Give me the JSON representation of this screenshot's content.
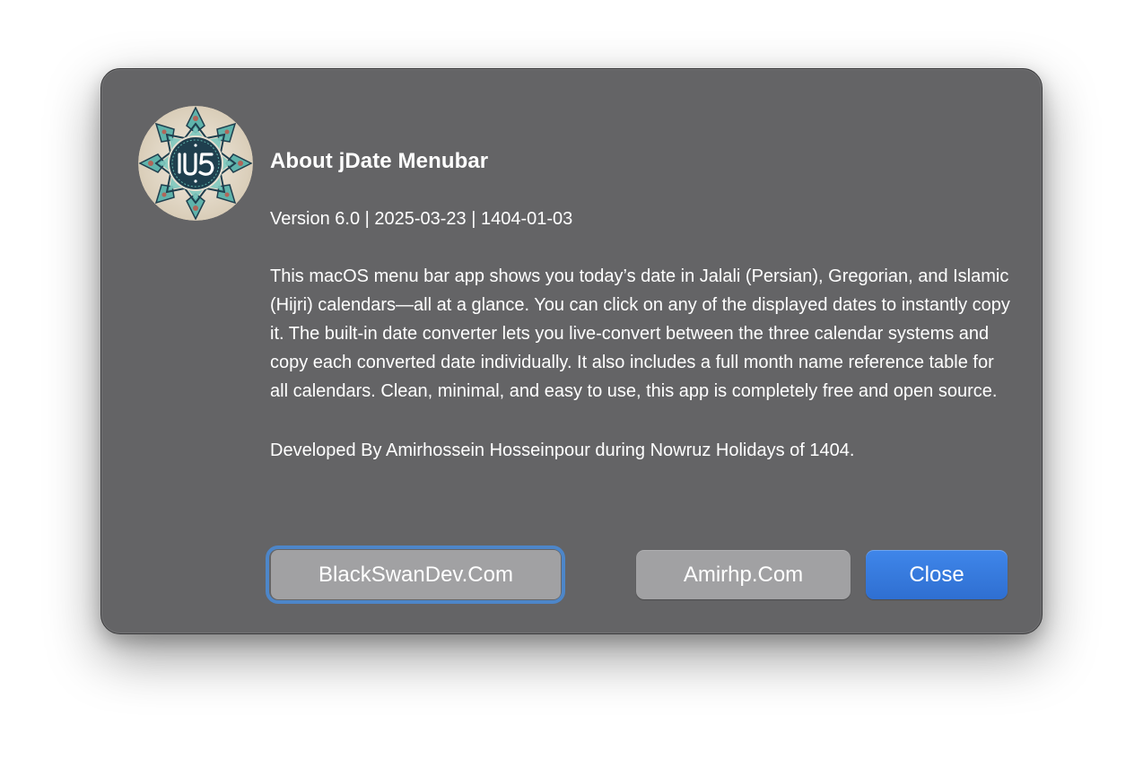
{
  "dialog": {
    "title": "About jDate Menubar",
    "version_line": "Version 6.0 | 2025-03-23 | 1404-01-03",
    "description": "This macOS menu bar app shows you today’s date in Jalali (Persian), Gregorian, and Islamic (Hijri) calendars—all at a glance. You can click on any of the displayed dates to instantly copy it. The built-in date converter lets you live-convert between the three calendar systems and copy each converted date individually. It also includes a full month name reference table for all calendars. Clean, minimal, and easy to use, this app is completely free and open source.",
    "developer_line": "Developed By Amirhossein Hosseinpour during Nowruz Holidays of 1404.",
    "app_icon": "jdate-app-icon",
    "buttons": {
      "blackswan_label": "BlackSwanDev.Com",
      "amirhp_label": "Amirhp.Com",
      "close_label": "Close"
    }
  },
  "colors": {
    "dialog_background": "#646466",
    "button_gray": "#a1a1a3",
    "button_blue": "#3479e0",
    "focus_ring": "#4d86c9",
    "icon_teal": "#5fb3ab",
    "icon_navy": "#1f3f4e"
  }
}
